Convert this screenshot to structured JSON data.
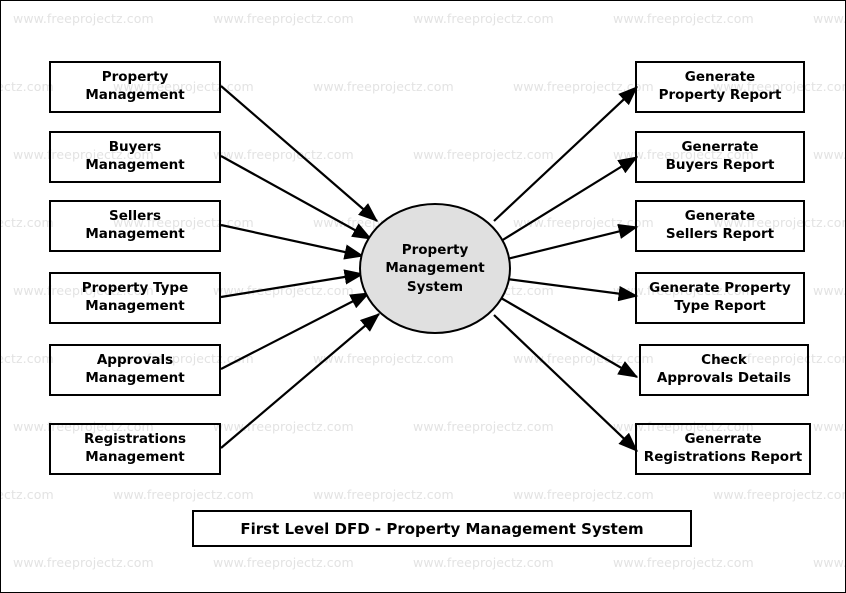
{
  "diagram": {
    "title": "First Level DFD - Property Management System",
    "process": {
      "name": "Property Management System",
      "line1": "Property",
      "line2": "Management",
      "line3": "System",
      "fill": "#e0e0e0",
      "stroke": "#000000"
    },
    "inputs": [
      {
        "id": "property-management",
        "line1": "Property",
        "line2": "Management"
      },
      {
        "id": "buyers-management",
        "line1": "Buyers",
        "line2": "Management"
      },
      {
        "id": "sellers-management",
        "line1": "Sellers",
        "line2": "Management"
      },
      {
        "id": "property-type-management",
        "line1": "Property Type",
        "line2": "Management"
      },
      {
        "id": "approvals-management",
        "line1": "Approvals",
        "line2": "Management"
      },
      {
        "id": "registrations-management",
        "line1": "Registrations",
        "line2": "Management"
      }
    ],
    "outputs": [
      {
        "id": "generate-property-report",
        "line1": "Generate",
        "line2": "Property Report"
      },
      {
        "id": "generate-buyers-report",
        "line1": "Generrate",
        "line2": "Buyers Report"
      },
      {
        "id": "generate-sellers-report",
        "line1": "Generate",
        "line2": "Sellers Report"
      },
      {
        "id": "generate-property-type-report",
        "line1": "Generate Property",
        "line2": "Type Report"
      },
      {
        "id": "check-approvals-details",
        "line1": "Check",
        "line2": "Approvals Details"
      },
      {
        "id": "generate-registrations-report",
        "line1": "Generrate",
        "line2": "Registrations Report"
      }
    ]
  },
  "watermark": {
    "text": "www.freeprojectz.com",
    "color": "#e3e3e3"
  }
}
